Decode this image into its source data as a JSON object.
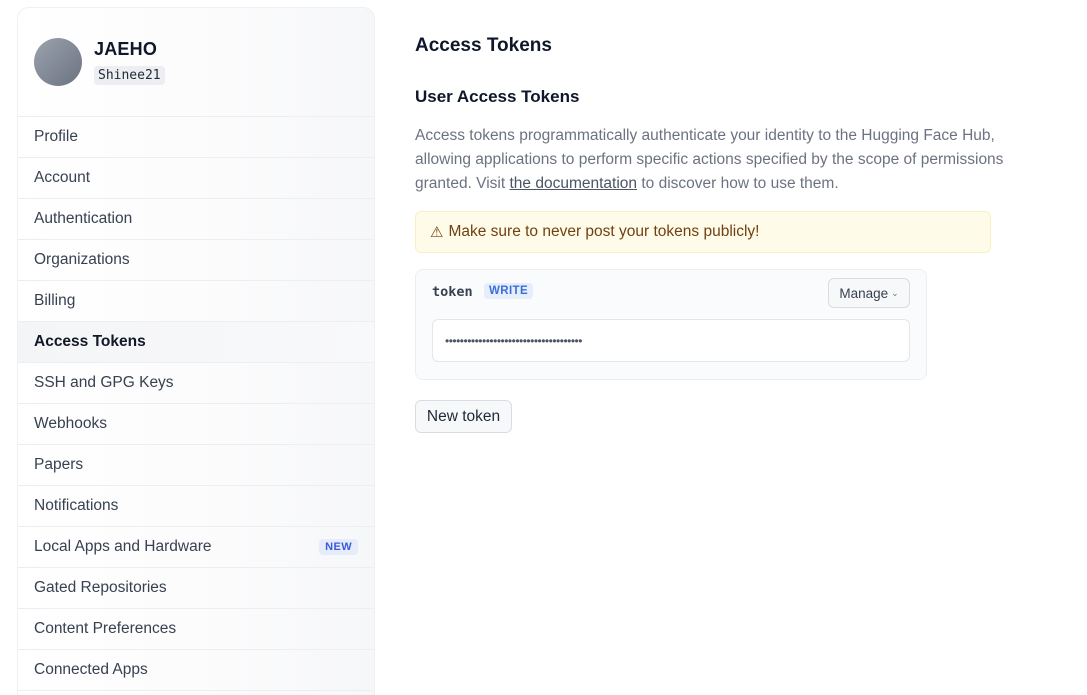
{
  "user": {
    "name": "JAEHO",
    "handle": "Shinee21"
  },
  "sidebar": {
    "items": [
      {
        "label": "Profile"
      },
      {
        "label": "Account"
      },
      {
        "label": "Authentication"
      },
      {
        "label": "Organizations"
      },
      {
        "label": "Billing"
      },
      {
        "label": "Access Tokens",
        "active": true
      },
      {
        "label": "SSH and GPG Keys"
      },
      {
        "label": "Webhooks"
      },
      {
        "label": "Papers"
      },
      {
        "label": "Notifications"
      },
      {
        "label": "Local Apps and Hardware",
        "badge": "NEW"
      },
      {
        "label": "Gated Repositories"
      },
      {
        "label": "Content Preferences"
      },
      {
        "label": "Connected Apps"
      }
    ]
  },
  "main": {
    "title": "Access Tokens",
    "section_title": "User Access Tokens",
    "description_before": "Access tokens programmatically authenticate your identity to the Hugging Face Hub, allowing applications to perform specific actions specified by the scope of permissions granted. Visit ",
    "description_link": "the documentation",
    "description_after": " to discover how to use them.",
    "warning_icon": "⚠",
    "warning": "Make sure to never post your tokens publicly!",
    "token": {
      "name": "token",
      "role": "WRITE",
      "manage_label": "Manage",
      "masked_value": "•••••••••••••••••••••••••••••••••••••"
    },
    "new_token_label": "New token"
  },
  "colors": {
    "warning_bg": "#fefce8",
    "warning_text": "#713f12",
    "badge_blue": "#3b6fd8",
    "active_item_bg": "#f4f5f7"
  }
}
